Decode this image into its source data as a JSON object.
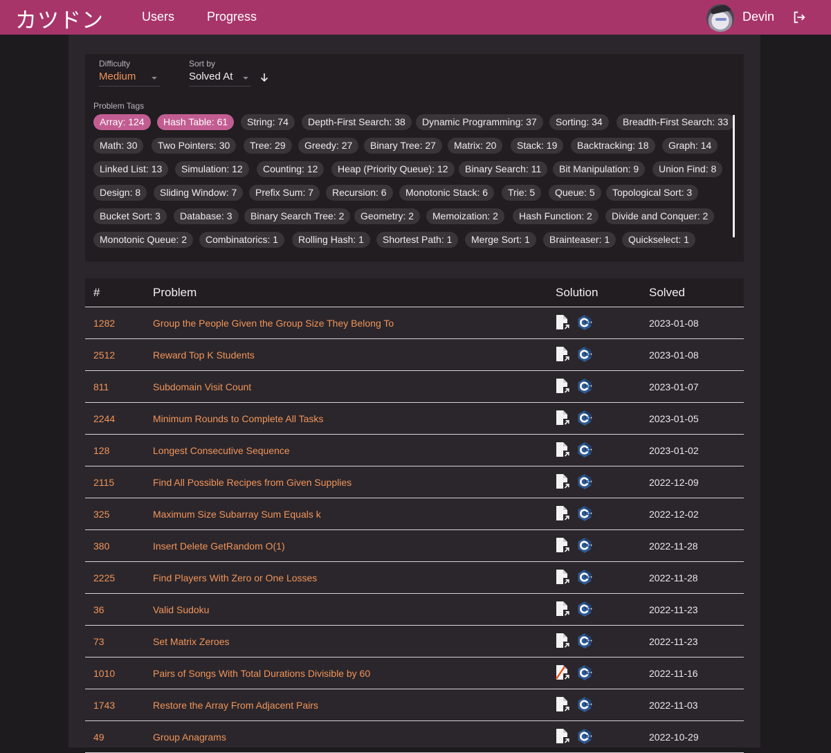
{
  "header": {
    "logo": "カツドン",
    "nav": [
      "Users",
      "Progress"
    ],
    "username": "Devin",
    "brand_color": "#a8356a"
  },
  "filters": {
    "difficulty_label": "Difficulty",
    "difficulty_value": "Medium",
    "sort_label": "Sort by",
    "sort_value": "Solved At",
    "sort_direction": "descending"
  },
  "tags": {
    "label": "Problem Tags",
    "items": [
      {
        "label": "Array: 124",
        "selected": true
      },
      {
        "label": "Hash Table: 61",
        "selected": true
      },
      {
        "label": "String: 74"
      },
      {
        "label": "Depth-First Search: 38"
      },
      {
        "label": "Dynamic Programming: 37"
      },
      {
        "label": "Sorting: 34"
      },
      {
        "label": "Breadth-First Search: 33"
      },
      {
        "label": "Math: 30"
      },
      {
        "label": "Two Pointers: 30"
      },
      {
        "label": "Tree: 29"
      },
      {
        "label": "Greedy: 27"
      },
      {
        "label": "Binary Tree: 27"
      },
      {
        "label": "Matrix: 20"
      },
      {
        "label": "Stack: 19"
      },
      {
        "label": "Backtracking: 18"
      },
      {
        "label": "Graph: 14"
      },
      {
        "label": "Linked List: 13"
      },
      {
        "label": "Simulation: 12"
      },
      {
        "label": "Counting: 12"
      },
      {
        "label": "Heap (Priority Queue): 12"
      },
      {
        "label": "Binary Search: 11"
      },
      {
        "label": "Bit Manipulation: 9"
      },
      {
        "label": "Union Find: 8"
      },
      {
        "label": "Design: 8"
      },
      {
        "label": "Sliding Window: 7"
      },
      {
        "label": "Prefix Sum: 7"
      },
      {
        "label": "Recursion: 6"
      },
      {
        "label": "Monotonic Stack: 6"
      },
      {
        "label": "Trie: 5"
      },
      {
        "label": "Queue: 5"
      },
      {
        "label": "Topological Sort: 3"
      },
      {
        "label": "Bucket Sort: 3"
      },
      {
        "label": "Database: 3"
      },
      {
        "label": "Binary Search Tree: 2"
      },
      {
        "label": "Geometry: 2"
      },
      {
        "label": "Memoization: 2"
      },
      {
        "label": "Hash Function: 2"
      },
      {
        "label": "Divide and Conquer: 2"
      },
      {
        "label": "Monotonic Queue: 2"
      },
      {
        "label": "Combinatorics: 1"
      },
      {
        "label": "Rolling Hash: 1"
      },
      {
        "label": "Shortest Path: 1"
      },
      {
        "label": "Merge Sort: 1"
      },
      {
        "label": "Brainteaser: 1"
      },
      {
        "label": "Quickselect: 1"
      }
    ]
  },
  "table": {
    "columns": [
      "#",
      "Problem",
      "Solution",
      "Solved"
    ],
    "rows": [
      {
        "id": "1282",
        "title": "Group the People Given the Group Size They Belong To",
        "date": "2023-01-08",
        "doc_icon": "document-link-icon",
        "lang_icon": "cpp-icon"
      },
      {
        "id": "2512",
        "title": "Reward Top K Students",
        "date": "2023-01-08",
        "doc_icon": "document-link-icon",
        "lang_icon": "cpp-icon"
      },
      {
        "id": "811",
        "title": "Subdomain Visit Count",
        "date": "2023-01-07",
        "doc_icon": "document-link-icon",
        "lang_icon": "cpp-icon"
      },
      {
        "id": "2244",
        "title": "Minimum Rounds to Complete All Tasks",
        "date": "2023-01-05",
        "doc_icon": "document-link-icon",
        "lang_icon": "cpp-icon"
      },
      {
        "id": "128",
        "title": "Longest Consecutive Sequence",
        "date": "2023-01-02",
        "doc_icon": "document-link-icon",
        "lang_icon": "cpp-icon"
      },
      {
        "id": "2115",
        "title": "Find All Possible Recipes from Given Supplies",
        "date": "2022-12-09",
        "doc_icon": "document-link-icon",
        "lang_icon": "cpp-icon"
      },
      {
        "id": "325",
        "title": "Maximum Size Subarray Sum Equals k",
        "date": "2022-12-02",
        "doc_icon": "document-link-icon",
        "lang_icon": "cpp-icon"
      },
      {
        "id": "380",
        "title": "Insert Delete GetRandom O(1)",
        "date": "2022-11-28",
        "doc_icon": "document-link-icon",
        "lang_icon": "cpp-icon"
      },
      {
        "id": "2225",
        "title": "Find Players With Zero or One Losses",
        "date": "2022-11-28",
        "doc_icon": "document-link-icon",
        "lang_icon": "cpp-icon"
      },
      {
        "id": "36",
        "title": "Valid Sudoku",
        "date": "2022-11-23",
        "doc_icon": "document-link-icon",
        "lang_icon": "cpp-icon"
      },
      {
        "id": "73",
        "title": "Set Matrix Zeroes",
        "date": "2022-11-23",
        "doc_icon": "document-link-icon",
        "lang_icon": "cpp-icon"
      },
      {
        "id": "1010",
        "title": "Pairs of Songs With Total Durations Divisible by 60",
        "date": "2022-11-16",
        "doc_icon": "document-link-off-icon",
        "lang_icon": "cpp-icon"
      },
      {
        "id": "1743",
        "title": "Restore the Array From Adjacent Pairs",
        "date": "2022-11-03",
        "doc_icon": "document-link-icon",
        "lang_icon": "cpp-icon"
      },
      {
        "id": "49",
        "title": "Group Anagrams",
        "date": "2022-10-29",
        "doc_icon": "document-link-icon",
        "lang_icon": "cpp-icon"
      }
    ]
  }
}
